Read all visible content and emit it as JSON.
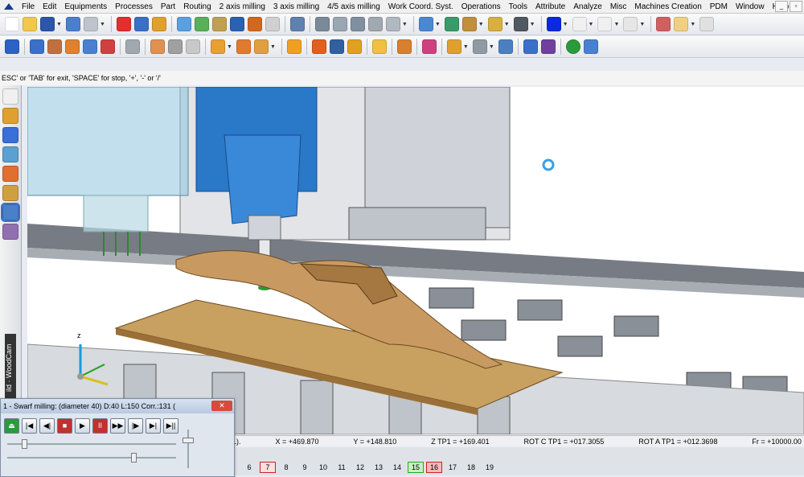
{
  "menu": {
    "items": [
      "File",
      "Edit",
      "Equipments",
      "Processes",
      "Part",
      "Routing",
      "2 axis milling",
      "3 axis milling",
      "4/5 axis milling",
      "Work Coord. Syst.",
      "Operations",
      "Tools",
      "Attribute",
      "Analyze",
      "Misc",
      "Machines Creation",
      "PDM",
      "Window",
      "Help"
    ]
  },
  "window_controls": {
    "minimize": "_",
    "restore": "▫"
  },
  "hint": "ESC' or 'TAB' for exit, 'SPACE' for stop, '+', '-' or '/'",
  "side_label": "ild · WoodCam",
  "coords": {
    "tail": "P1).",
    "x": "X = +469.870",
    "y": "Y = +148.810",
    "z": "Z TP1 = +169.401",
    "rotc": "ROT C TP1 = +017.3055",
    "rota": "ROT A TP1 = +012.3698",
    "fr": "Fr = +10000.00"
  },
  "pages": [
    {
      "label": "6",
      "style": ""
    },
    {
      "label": "7",
      "style": "red"
    },
    {
      "label": "8",
      "style": ""
    },
    {
      "label": "9",
      "style": ""
    },
    {
      "label": "10",
      "style": ""
    },
    {
      "label": "11",
      "style": ""
    },
    {
      "label": "12",
      "style": ""
    },
    {
      "label": "13",
      "style": ""
    },
    {
      "label": "14",
      "style": ""
    },
    {
      "label": "15",
      "style": "green"
    },
    {
      "label": "16",
      "style": "redfill"
    },
    {
      "label": "17",
      "style": ""
    },
    {
      "label": "18",
      "style": ""
    },
    {
      "label": "19",
      "style": ""
    }
  ],
  "sim": {
    "title": "1 - Swarf milling:   (diameter 40)  D:40  L:150  Corr.:131  (",
    "close": "✕",
    "buttons": [
      "⏏",
      "|◀",
      "◀|",
      "■",
      "▶",
      "II",
      "▶▶",
      "|▶",
      "▶|",
      "▶||"
    ]
  },
  "colors": {
    "accent": "#2c62c7",
    "wood": "#c89a62",
    "blue_head": "#2a78c8"
  }
}
